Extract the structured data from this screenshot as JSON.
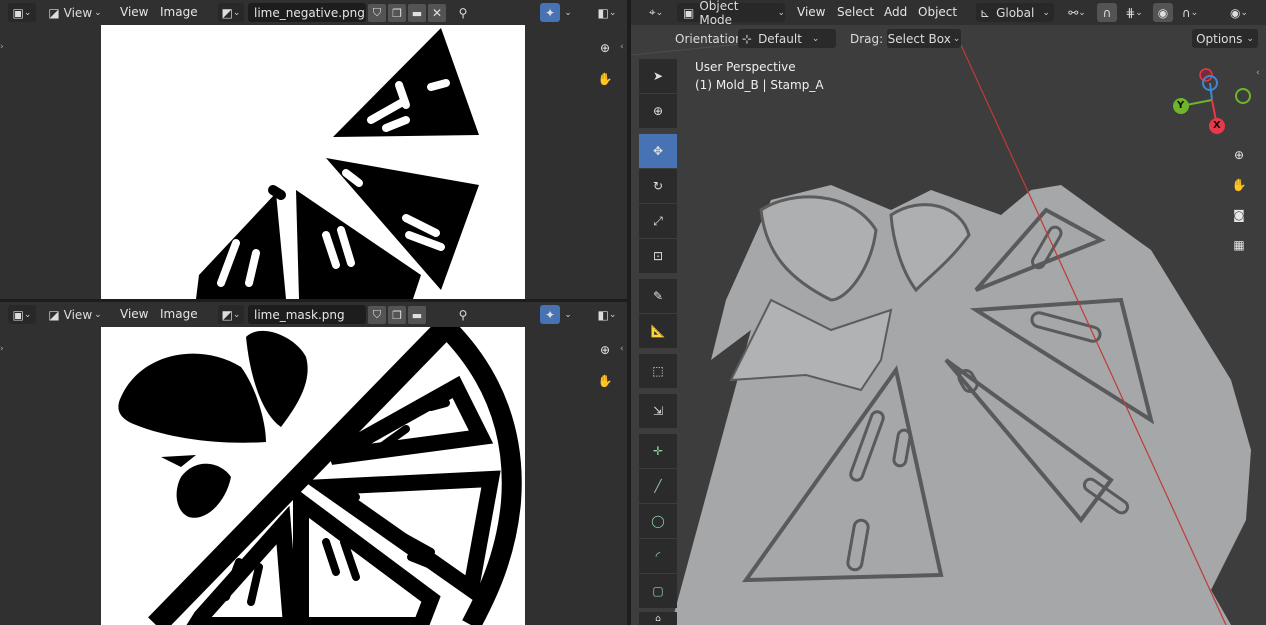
{
  "editor_top": {
    "menus": [
      "View",
      "View",
      "Image"
    ],
    "image_name": "lime_negative.png"
  },
  "editor_bottom": {
    "menus": [
      "View",
      "View",
      "Image"
    ],
    "image_name": "lime_mask.png"
  },
  "viewport": {
    "mode": "Object Mode",
    "menus": [
      "View",
      "Select",
      "Add",
      "Object"
    ],
    "transform_orientation": "Global",
    "orientation_label": "Orientation:",
    "orientation_value": "Default",
    "drag_label": "Drag:",
    "drag_value": "Select Box",
    "options_label": "Options",
    "overlay_line1": "User Perspective",
    "overlay_line2": "(1) Mold_B | Stamp_A",
    "gizmo_axes": [
      "Y",
      "X"
    ]
  },
  "colors": {
    "active_tool": "#4772b3",
    "axis_x": "#e8394a",
    "axis_y": "#6fb52c",
    "axis_z": "#3f87d6",
    "model_gray": "#a5a7a8"
  },
  "icons": {
    "editor_type": "image-editor-icon",
    "display_mode": "display-mode-icon",
    "zoom": "zoom-icon",
    "pan": "hand-icon",
    "camera": "camera-icon",
    "grid": "grid-icon"
  }
}
